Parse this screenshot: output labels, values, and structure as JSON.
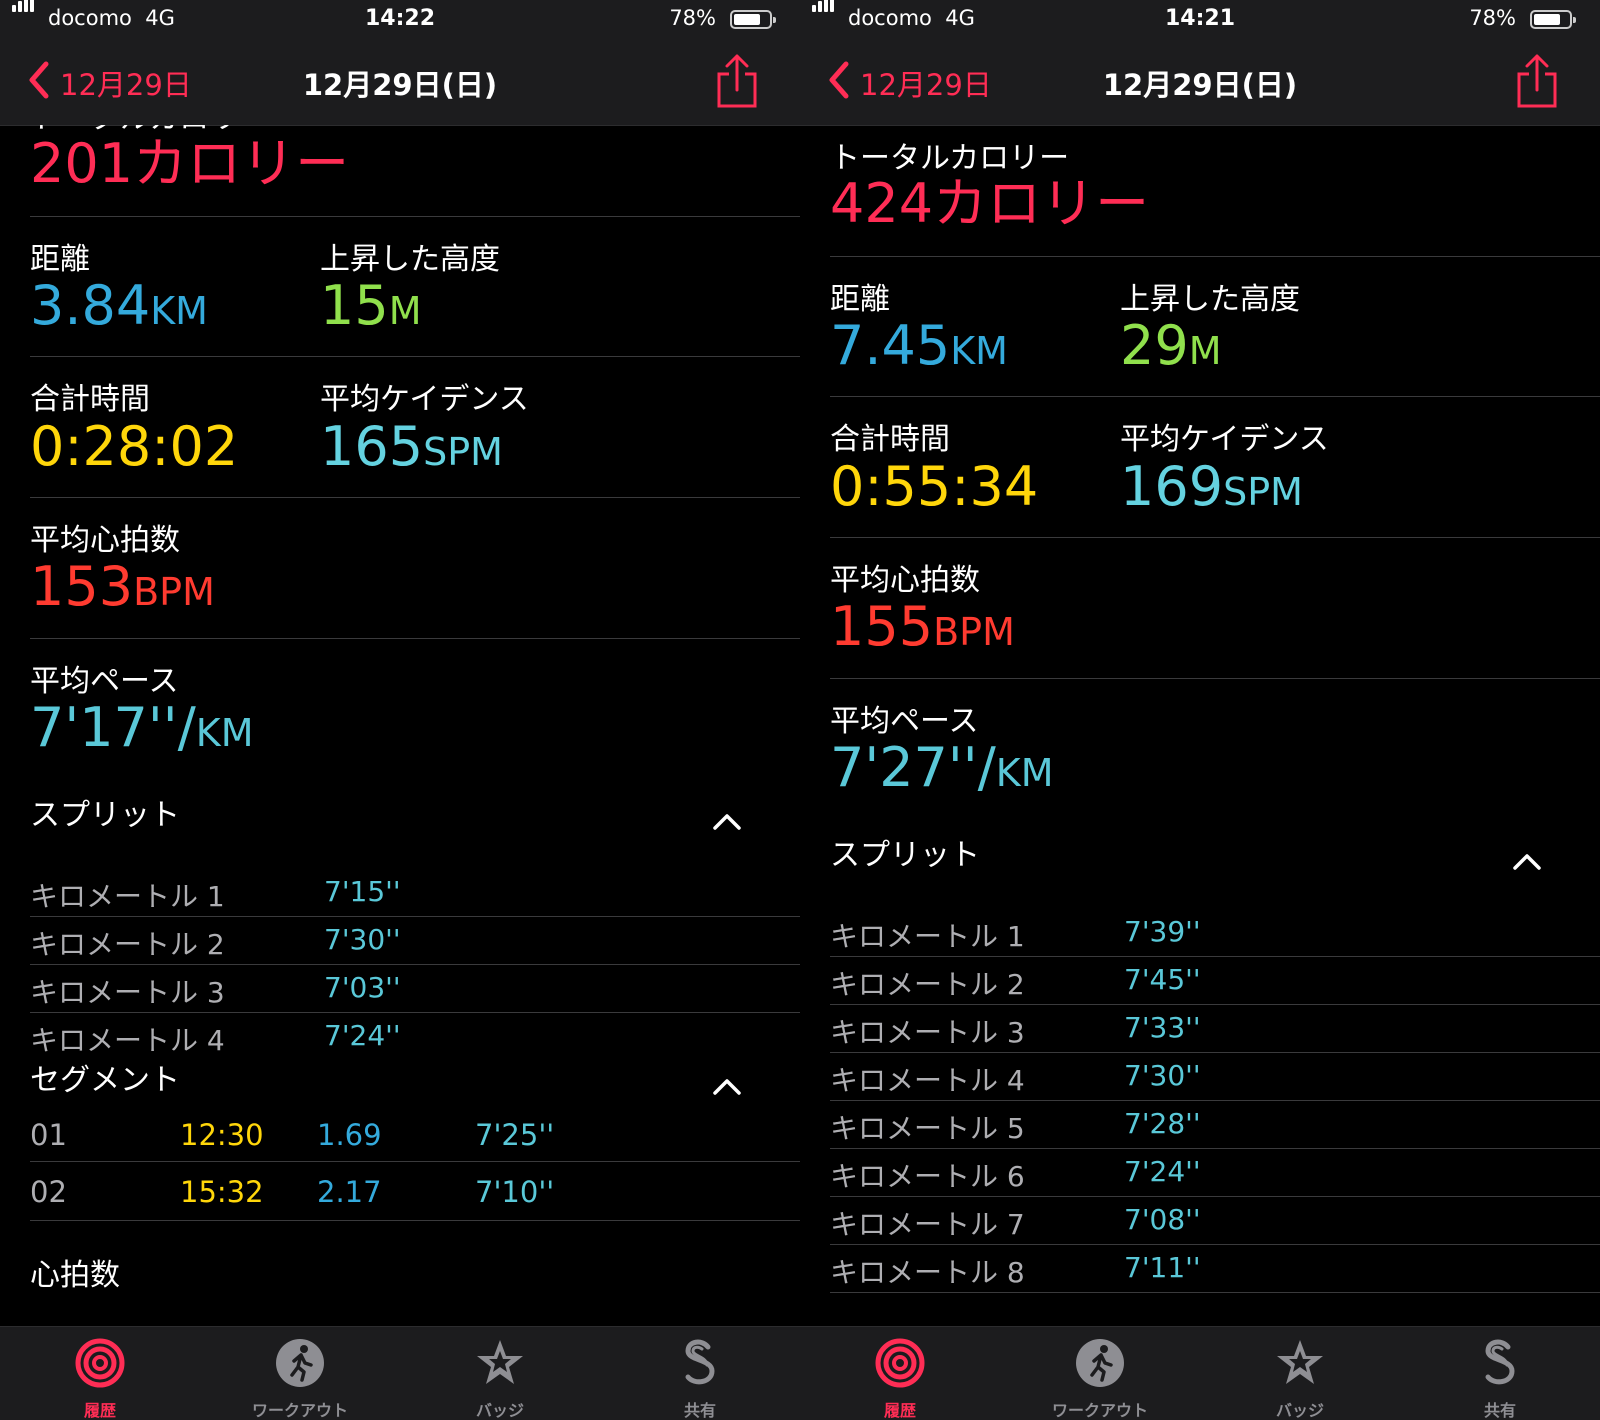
{
  "colors": {
    "accent": "#ff2d55",
    "calories": "#ff2d55",
    "distance": "#34aadc",
    "elevation": "#90e04c",
    "time": "#ffd60a",
    "cadence": "#64d2e0",
    "heart": "#ff3b30",
    "pace": "#5ac8d8",
    "split_name": "#aeaeb2",
    "segment_time": "#ffd60a",
    "segment_distance": "#34aadc",
    "segment_pace": "#5ac8d8"
  },
  "icons": {
    "back": "chevron-left-icon",
    "share": "share-icon",
    "collapse": "chevron-up-icon",
    "tabs": [
      "activity-rings-icon",
      "running-figure-icon",
      "badge-star-icon",
      "sharing-icon"
    ]
  },
  "screens": [
    {
      "status": {
        "carrier": "docomo",
        "network": "4G",
        "time": "14:22",
        "battery": "78%",
        "battery_level": 0.78
      },
      "nav": {
        "back": "12月29日",
        "title": "12月29日(日)"
      },
      "calories": {
        "label": "トータルカロリー",
        "value": "201",
        "unit": "カロリー"
      },
      "distance": {
        "label": "距離",
        "value": "3.84",
        "unit": "KM"
      },
      "elevation": {
        "label": "上昇した高度",
        "value": "15",
        "unit": "M"
      },
      "duration": {
        "label": "合計時間",
        "value": "0:28:02"
      },
      "cadence": {
        "label": "平均ケイデンス",
        "value": "165",
        "unit": "SPM"
      },
      "heart_rate": {
        "label": "平均心拍数",
        "value": "153",
        "unit": "BPM"
      },
      "pace": {
        "label": "平均ペース",
        "value": "7'17''/",
        "unit": "KM"
      },
      "splits_title": "スプリット",
      "splits": [
        {
          "name": "キロメートル 1",
          "pace": "7'15''"
        },
        {
          "name": "キロメートル 2",
          "pace": "7'30''"
        },
        {
          "name": "キロメートル 3",
          "pace": "7'03''"
        },
        {
          "name": "キロメートル 4",
          "pace": "7'24''"
        }
      ],
      "segments_title": "セグメント",
      "segments": [
        {
          "num": "01",
          "time": "12:30",
          "distance": "1.69",
          "pace": "7'25''"
        },
        {
          "num": "02",
          "time": "15:32",
          "distance": "2.17",
          "pace": "7'10''"
        }
      ],
      "heart_section_title": "心拍数",
      "tabs": [
        "履歴",
        "ワークアウト",
        "バッジ",
        "共有"
      ]
    },
    {
      "status": {
        "carrier": "docomo",
        "network": "4G",
        "time": "14:21",
        "battery": "78%",
        "battery_level": 0.78
      },
      "nav": {
        "back": "12月29日",
        "title": "12月29日(日)"
      },
      "calories": {
        "label": "トータルカロリー",
        "value": "424",
        "unit": "カロリー"
      },
      "distance": {
        "label": "距離",
        "value": "7.45",
        "unit": "KM"
      },
      "elevation": {
        "label": "上昇した高度",
        "value": "29",
        "unit": "M"
      },
      "duration": {
        "label": "合計時間",
        "value": "0:55:34"
      },
      "cadence": {
        "label": "平均ケイデンス",
        "value": "169",
        "unit": "SPM"
      },
      "heart_rate": {
        "label": "平均心拍数",
        "value": "155",
        "unit": "BPM"
      },
      "pace": {
        "label": "平均ペース",
        "value": "7'27''/",
        "unit": "KM"
      },
      "splits_title": "スプリット",
      "splits": [
        {
          "name": "キロメートル 1",
          "pace": "7'39''"
        },
        {
          "name": "キロメートル 2",
          "pace": "7'45''"
        },
        {
          "name": "キロメートル 3",
          "pace": "7'33''"
        },
        {
          "name": "キロメートル 4",
          "pace": "7'30''"
        },
        {
          "name": "キロメートル 5",
          "pace": "7'28''"
        },
        {
          "name": "キロメートル 6",
          "pace": "7'24''"
        },
        {
          "name": "キロメートル 7",
          "pace": "7'08''"
        },
        {
          "name": "キロメートル 8",
          "pace": "7'11''"
        }
      ],
      "tabs": [
        "履歴",
        "ワークアウト",
        "バッジ",
        "共有"
      ]
    }
  ]
}
